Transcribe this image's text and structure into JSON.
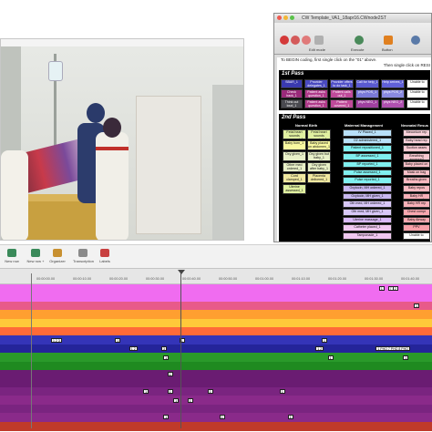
{
  "coding_window": {
    "title": "CW Template_VA1_18apr16.CWnode2ST",
    "toolbar": [
      {
        "label": "Edit mode",
        "color": "#b0b0b0"
      },
      {
        "label": "Execute",
        "color": "#4a8a5a"
      },
      {
        "label": "Button",
        "color": "#e08020"
      }
    ],
    "instructions": [
      "To BEGIN coding, first single click on the \"01\" above.",
      "Then single click on RESI"
    ],
    "first_pass": {
      "heading": "1st Pass",
      "chips": [
        {
          "label": "SBAR_1",
          "color": "#3a3ab0"
        },
        {
          "label": "Provider delegates_1",
          "color": "#4a4ac0"
        },
        {
          "label": "Provider offers to do task_1",
          "color": "#5050c8"
        },
        {
          "label": "Call for help_1",
          "color": "#5a5ad0"
        },
        {
          "label": "Help arrives_1",
          "color": "#6060d8"
        },
        {
          "label": "Unable to",
          "color": "#ffffff"
        },
        {
          "label": "Check back_1",
          "color": "#9a2a7a"
        },
        {
          "label": "Patient asks question_1",
          "color": "#b03a8a"
        },
        {
          "label": "Patient calls out_1",
          "color": "#c04a9a"
        },
        {
          "label": "phys POS_1",
          "color": "#7a7ad8"
        },
        {
          "label": "phys POS_2",
          "color": "#8a8ae0"
        },
        {
          "label": "Unable to",
          "color": "#ffffff"
        },
        {
          "label": "Think out loud_1",
          "color": "#4a4a50"
        },
        {
          "label": "Patient asks question_1",
          "color": "#b03a8a"
        },
        {
          "label": "Patient covered_1",
          "color": "#c04a9a"
        },
        {
          "label": "phys NEG_1",
          "color": "#a040a0"
        },
        {
          "label": "phys NEG_2",
          "color": "#b050b0"
        },
        {
          "label": "Unable to",
          "color": "#ffffff"
        }
      ]
    },
    "second_pass": {
      "heading": "2nd Pass",
      "columns": [
        "Normal Birth",
        "Maternal Management",
        "Neonatal Resus"
      ],
      "col1": [
        "Fetal heart sounds assessed_1",
        "Fetal heart sounds reported_1",
        "Baby born_1",
        "Baby placed on abdomen_1",
        "Oxy given_1",
        "Oxy given but baby_1",
        "Other med ordered_1",
        "Oxy given after baby_1",
        "Cord clamped_1",
        "Placenta delivered_1",
        "Uterine assessed_1"
      ],
      "col2": [
        "IV Placed_1",
        "O2 administered_1",
        "Patient repositioned_1",
        "BP assessed_1",
        "BP reported_1",
        "Pulse assessed_1",
        "Pulse reported_1",
        "Oxytocin, MH ordered_1",
        "Oxytocin, MH given_1",
        "Oth med, MH ordered_1",
        "Oth med, MH given_1",
        "Uterine massage_1",
        "Catheter placed_1",
        "Tamponade_1"
      ],
      "col3": [
        "Meconium rep",
        "Baby head rep",
        "Suction asses",
        "Breathing assessed",
        "Baby placed on",
        "Mask on bag",
        "Breaths given",
        "Baby repos",
        "Baby HR assessed",
        "Baby HR rep",
        "Chest compr",
        "Baby Airway",
        "PPV",
        "Unable to"
      ]
    }
  },
  "timeline": {
    "buttons": [
      {
        "label": "New row",
        "color": "#3a8a5a"
      },
      {
        "label": "New row +",
        "color": "#3a8a5a"
      },
      {
        "label": "Organizer",
        "color": "#c89030"
      },
      {
        "label": "Transcription",
        "color": "#8a8a8a"
      },
      {
        "label": "Labels",
        "color": "#c84040"
      }
    ],
    "ruler": [
      "00:00:00.00",
      "00:00:10.00",
      "00:00:20.00",
      "00:00:30.00",
      "00:00:40.00",
      "00:00:50.00",
      "00:01:00.00",
      "00:01:10.00",
      "00:01:20.00",
      "00:01:30.00",
      "00:01:40.00",
      "00:01:50.00"
    ],
    "tracks": [
      {
        "color": "#f06cf0",
        "events": [
          {
            "t": 0.868,
            "label": "1"
          },
          {
            "t": 0.902,
            "label": "2"
          },
          {
            "t": 0.89,
            "label": "7"
          }
        ]
      },
      {
        "color": "#f06cf0",
        "events": []
      },
      {
        "color": "#e85a8a",
        "events": [
          {
            "t": 0.955,
            "label": "1"
          }
        ]
      },
      {
        "color": "#ff9f30",
        "events": []
      },
      {
        "color": "#ffc93a",
        "events": []
      },
      {
        "color": "#ff6a38",
        "events": []
      },
      {
        "color": "#3434b8",
        "events": [
          {
            "t": 0.05,
            "label": "1 2 3"
          },
          {
            "t": 0.21,
            "label": "1"
          },
          {
            "t": 0.37,
            "label": "1"
          },
          {
            "t": 0.725,
            "label": "1"
          }
        ]
      },
      {
        "color": "#24249a",
        "events": [
          {
            "t": 0.245,
            "label": "1 2"
          },
          {
            "t": 0.325,
            "label": "3"
          },
          {
            "t": 0.71,
            "label": "1 2"
          },
          {
            "t": 0.86,
            "label": "1 PHO 7 PHO 8 PHO"
          }
        ]
      },
      {
        "color": "#2a9a2a",
        "events": [
          {
            "t": 0.33,
            "label": "1"
          },
          {
            "t": 0.74,
            "label": "1"
          },
          {
            "t": 0.928,
            "label": "1"
          }
        ]
      },
      {
        "color": "#1f8a20",
        "events": []
      },
      {
        "color": "#6a1c72",
        "events": [
          {
            "t": 0.34,
            "label": "1"
          }
        ]
      },
      {
        "color": "#6a1c72",
        "events": []
      },
      {
        "color": "#7a2480",
        "events": [
          {
            "t": 0.28,
            "label": "1"
          },
          {
            "t": 0.34,
            "label": "1"
          },
          {
            "t": 0.44,
            "label": "1"
          },
          {
            "t": 0.62,
            "label": "1"
          }
        ]
      },
      {
        "color": "#8a2a8a",
        "events": [
          {
            "t": 0.355,
            "label": "1"
          },
          {
            "t": 0.39,
            "label": "1"
          }
        ]
      },
      {
        "color": "#7a2480",
        "events": []
      },
      {
        "color": "#8a2a8a",
        "events": [
          {
            "t": 0.33,
            "label": "1"
          },
          {
            "t": 0.47,
            "label": "1"
          },
          {
            "t": 0.64,
            "label": "1"
          }
        ]
      },
      {
        "color": "#c03a2a",
        "events": []
      }
    ]
  }
}
